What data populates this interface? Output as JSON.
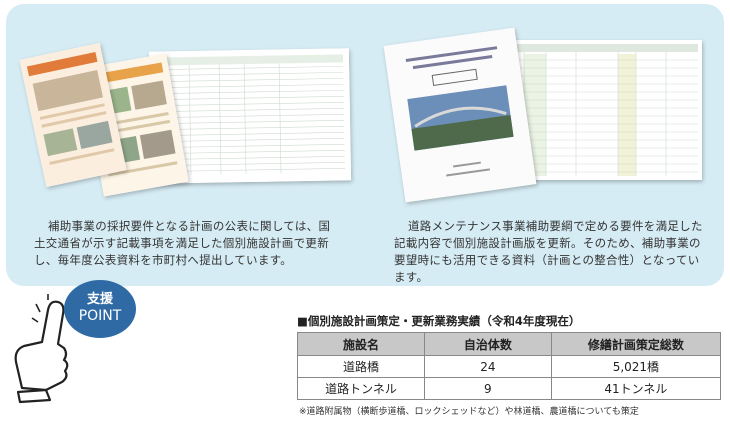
{
  "left_caption": [
    "補助事業の採択要件となる計画の公表に関しては、国",
    "土交通省が示す記載事項を満足した個別施設計画で更新",
    "し、毎年度公表資料を市町村へ提出しています。"
  ],
  "right_caption": [
    "道路メンテナンス事業補助要綱で定める要件を満足した",
    "記載内容で個別施設計画版を更新。そのため、補助事業の",
    "要望時にも活用できる資料（計画との整合性）となってい",
    "ます。"
  ],
  "badge": {
    "line1": "支援",
    "line2": "POINT"
  },
  "table": {
    "title": "■個別施設計画策定・更新業務実績（令和4年度現在）",
    "headers": [
      "施設名",
      "自治体数",
      "修繕計画策定総数"
    ],
    "rows": [
      [
        "道路橋",
        "24",
        "5,021橋"
      ],
      [
        "道路トンネル",
        "9",
        "41トンネル"
      ]
    ],
    "note": "※道路附属物（横断歩道橋、ロックシェッドなど）や林道橋、農道橋についても策定"
  },
  "colors": {
    "panel": "#d6ecf4",
    "badge": "#2f6aa5",
    "header": "#c8c8c8"
  }
}
